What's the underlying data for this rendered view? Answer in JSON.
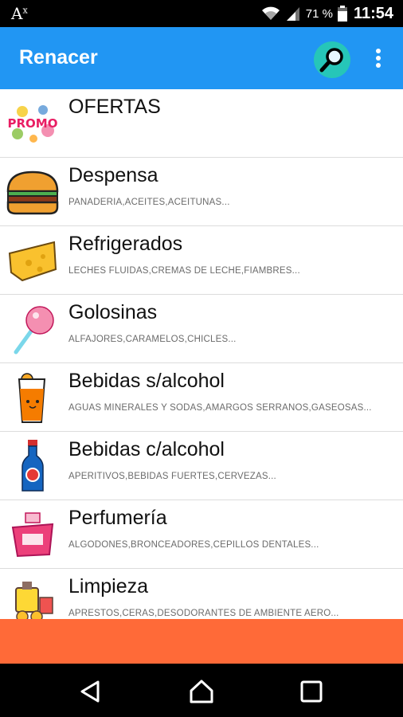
{
  "status_bar": {
    "signal_label": "A",
    "signal_sup": "x",
    "battery": "71 %",
    "time": "11:54"
  },
  "app_bar": {
    "title": "Renacer"
  },
  "categories": [
    {
      "title": "OFERTAS",
      "subtitle": "",
      "icon": "promo-icon"
    },
    {
      "title": "Despensa",
      "subtitle": "PANADERIA,ACEITES,ACEITUNAS...",
      "icon": "burger-icon"
    },
    {
      "title": "Refrigerados",
      "subtitle": "LECHES FLUIDAS,CREMAS DE LECHE,FIAMBRES...",
      "icon": "cheese-icon"
    },
    {
      "title": "Golosinas",
      "subtitle": "ALFAJORES,CARAMELOS,CHICLES...",
      "icon": "lollipop-icon"
    },
    {
      "title": "Bebidas s/alcohol",
      "subtitle": "AGUAS MINERALES Y SODAS,AMARGOS SERRANOS,GASEOSAS...",
      "icon": "juice-icon"
    },
    {
      "title": "Bebidas c/alcohol",
      "subtitle": "APERITIVOS,BEBIDAS FUERTES,CERVEZAS...",
      "icon": "bottle-icon"
    },
    {
      "title": "Perfumería",
      "subtitle": "ALGODONES,BRONCEADORES,CEPILLOS DENTALES...",
      "icon": "perfume-icon"
    },
    {
      "title": "Limpieza",
      "subtitle": "APRESTOS,CERAS,DESODORANTES DE AMBIENTE AERO...",
      "icon": "cleaning-icon"
    }
  ],
  "colors": {
    "app_bar": "#2196f3",
    "search_button": "#26c6b8",
    "bottom_banner": "#ff6a38"
  }
}
